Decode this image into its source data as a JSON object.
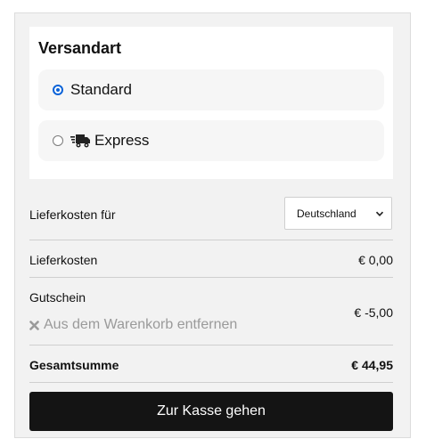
{
  "shipping": {
    "title": "Versandart",
    "options": [
      {
        "label": "Standard",
        "selected": true
      },
      {
        "label": "Express",
        "selected": false,
        "icon": "truck-icon"
      }
    ]
  },
  "summary": {
    "country_label": "Lieferkosten für",
    "country_value": "Deutschland",
    "shipping_cost_label": "Lieferkosten",
    "shipping_cost_value": "€ 0,00",
    "voucher_label": "Gutschein",
    "voucher_value": "€ -5,00",
    "voucher_remove": "Aus dem Warenkorb entfernen",
    "total_label": "Gesamtsumme",
    "total_value": "€ 44,95"
  },
  "checkout": {
    "button_label": "Zur Kasse gehen"
  },
  "colors": {
    "accent": "#0b63d8",
    "button_bg": "#141414",
    "panel_bg": "#f2f2f2"
  }
}
